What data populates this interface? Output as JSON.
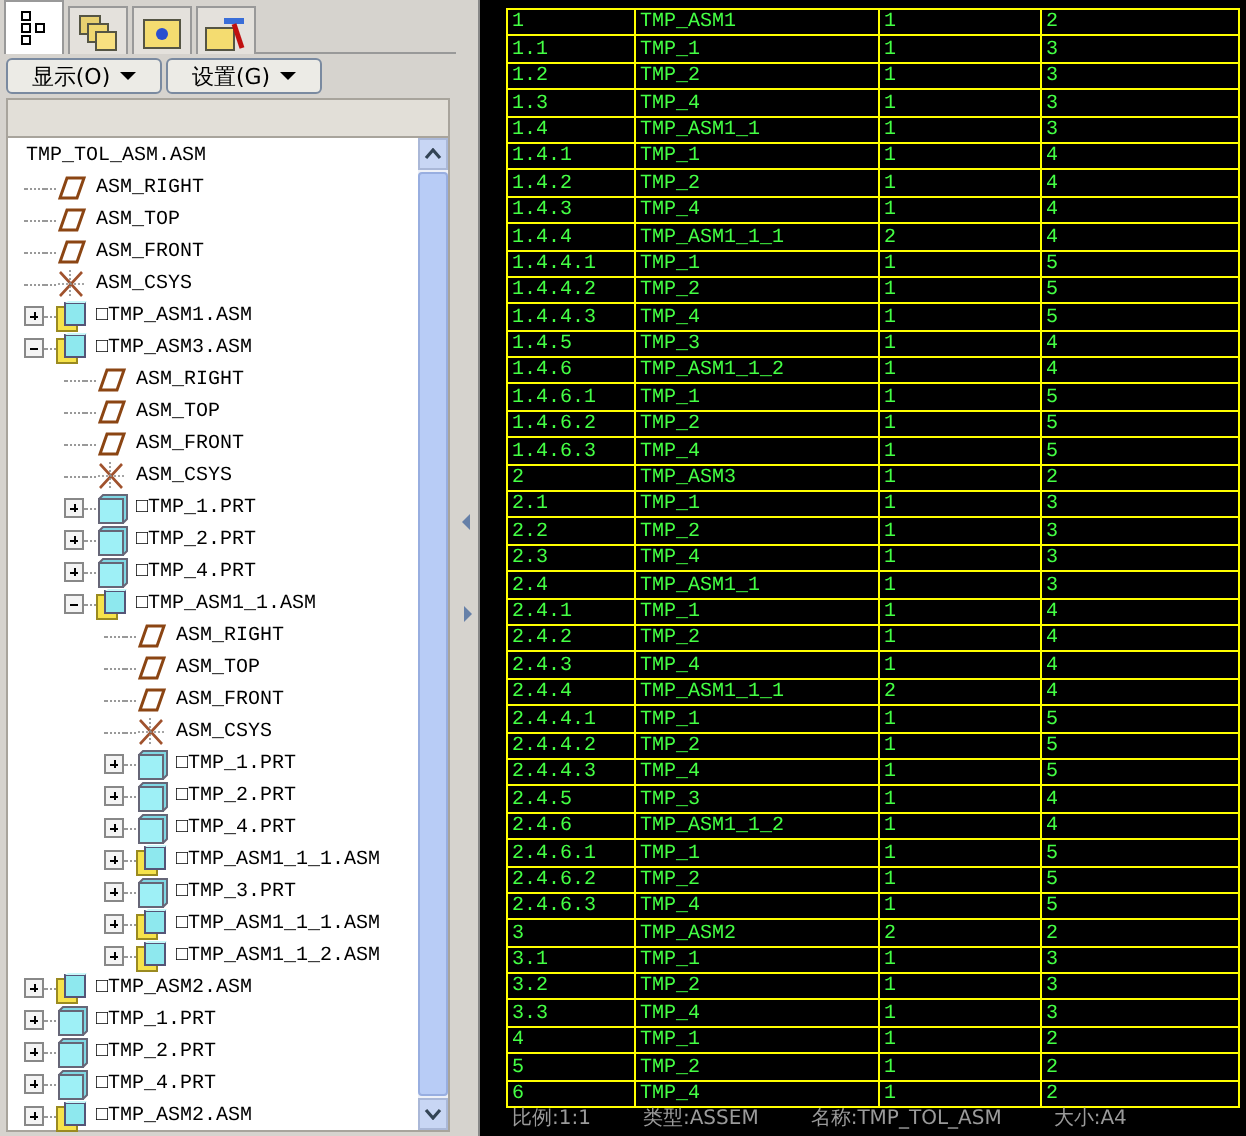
{
  "tabs": [
    {
      "kind": "model-tree",
      "selected": true
    },
    {
      "kind": "folders",
      "selected": false
    },
    {
      "kind": "favorites",
      "selected": false
    },
    {
      "kind": "tools",
      "selected": false
    }
  ],
  "toolbar": {
    "buttons": [
      "显示(O)",
      "设置(G)"
    ]
  },
  "model_tree": {
    "items": [
      {
        "kind": "root",
        "label": "TMP_TOL_ASM.ASM",
        "children": [
          {
            "kind": "datum-plane",
            "label": "ASM_RIGHT"
          },
          {
            "kind": "datum-plane",
            "label": "ASM_TOP"
          },
          {
            "kind": "datum-plane",
            "label": "ASM_FRONT"
          },
          {
            "kind": "csys",
            "label": "ASM_CSYS"
          },
          {
            "kind": "assembly",
            "label": "□TMP_ASM1.ASM",
            "expanded": false
          },
          {
            "kind": "assembly",
            "label": "□TMP_ASM3.ASM",
            "expanded": true,
            "children": [
              {
                "kind": "datum-plane",
                "label": "ASM_RIGHT"
              },
              {
                "kind": "datum-plane",
                "label": "ASM_TOP"
              },
              {
                "kind": "datum-plane",
                "label": "ASM_FRONT"
              },
              {
                "kind": "csys",
                "label": "ASM_CSYS"
              },
              {
                "kind": "part",
                "label": "□TMP_1.PRT",
                "expanded": false
              },
              {
                "kind": "part",
                "label": "□TMP_2.PRT",
                "expanded": false
              },
              {
                "kind": "part",
                "label": "□TMP_4.PRT",
                "expanded": false
              },
              {
                "kind": "assembly",
                "label": "□TMP_ASM1_1.ASM",
                "expanded": true,
                "children": [
                  {
                    "kind": "datum-plane",
                    "label": "ASM_RIGHT"
                  },
                  {
                    "kind": "datum-plane",
                    "label": "ASM_TOP"
                  },
                  {
                    "kind": "datum-plane",
                    "label": "ASM_FRONT"
                  },
                  {
                    "kind": "csys",
                    "label": "ASM_CSYS"
                  },
                  {
                    "kind": "part",
                    "label": "□TMP_1.PRT",
                    "expanded": false
                  },
                  {
                    "kind": "part",
                    "label": "□TMP_2.PRT",
                    "expanded": false
                  },
                  {
                    "kind": "part",
                    "label": "□TMP_4.PRT",
                    "expanded": false
                  },
                  {
                    "kind": "assembly",
                    "label": "□TMP_ASM1_1_1.ASM",
                    "expanded": false
                  },
                  {
                    "kind": "part",
                    "label": "□TMP_3.PRT",
                    "expanded": false
                  },
                  {
                    "kind": "assembly",
                    "label": "□TMP_ASM1_1_1.ASM",
                    "expanded": false
                  },
                  {
                    "kind": "assembly",
                    "label": "□TMP_ASM1_1_2.ASM",
                    "expanded": false
                  }
                ]
              }
            ]
          },
          {
            "kind": "assembly",
            "label": "□TMP_ASM2.ASM",
            "expanded": false
          },
          {
            "kind": "part",
            "label": "□TMP_1.PRT",
            "expanded": false
          },
          {
            "kind": "part",
            "label": "□TMP_2.PRT",
            "expanded": false
          },
          {
            "kind": "part",
            "label": "□TMP_4.PRT",
            "expanded": false
          },
          {
            "kind": "assembly",
            "label": "□TMP_ASM2.ASM",
            "expanded": false
          }
        ]
      }
    ]
  },
  "table": {
    "rows": [
      [
        "1",
        "TMP_ASM1",
        "1",
        "2"
      ],
      [
        "1.1",
        "TMP_1",
        "1",
        "3"
      ],
      [
        "1.2",
        "TMP_2",
        "1",
        "3"
      ],
      [
        "1.3",
        "TMP_4",
        "1",
        "3"
      ],
      [
        "1.4",
        "TMP_ASM1_1",
        "1",
        "3"
      ],
      [
        "1.4.1",
        "TMP_1",
        "1",
        "4"
      ],
      [
        "1.4.2",
        "TMP_2",
        "1",
        "4"
      ],
      [
        "1.4.3",
        "TMP_4",
        "1",
        "4"
      ],
      [
        "1.4.4",
        "TMP_ASM1_1_1",
        "2",
        "4"
      ],
      [
        "1.4.4.1",
        "TMP_1",
        "1",
        "5"
      ],
      [
        "1.4.4.2",
        "TMP_2",
        "1",
        "5"
      ],
      [
        "1.4.4.3",
        "TMP_4",
        "1",
        "5"
      ],
      [
        "1.4.5",
        "TMP_3",
        "1",
        "4"
      ],
      [
        "1.4.6",
        "TMP_ASM1_1_2",
        "1",
        "4"
      ],
      [
        "1.4.6.1",
        "TMP_1",
        "1",
        "5"
      ],
      [
        "1.4.6.2",
        "TMP_2",
        "1",
        "5"
      ],
      [
        "1.4.6.3",
        "TMP_4",
        "1",
        "5"
      ],
      [
        "2",
        "TMP_ASM3",
        "1",
        "2"
      ],
      [
        "2.1",
        "TMP_1",
        "1",
        "3"
      ],
      [
        "2.2",
        "TMP_2",
        "1",
        "3"
      ],
      [
        "2.3",
        "TMP_4",
        "1",
        "3"
      ],
      [
        "2.4",
        "TMP_ASM1_1",
        "1",
        "3"
      ],
      [
        "2.4.1",
        "TMP_1",
        "1",
        "4"
      ],
      [
        "2.4.2",
        "TMP_2",
        "1",
        "4"
      ],
      [
        "2.4.3",
        "TMP_4",
        "1",
        "4"
      ],
      [
        "2.4.4",
        "TMP_ASM1_1_1",
        "2",
        "4"
      ],
      [
        "2.4.4.1",
        "TMP_1",
        "1",
        "5"
      ],
      [
        "2.4.4.2",
        "TMP_2",
        "1",
        "5"
      ],
      [
        "2.4.4.3",
        "TMP_4",
        "1",
        "5"
      ],
      [
        "2.4.5",
        "TMP_3",
        "1",
        "4"
      ],
      [
        "2.4.6",
        "TMP_ASM1_1_2",
        "1",
        "4"
      ],
      [
        "2.4.6.1",
        "TMP_1",
        "1",
        "5"
      ],
      [
        "2.4.6.2",
        "TMP_2",
        "1",
        "5"
      ],
      [
        "2.4.6.3",
        "TMP_4",
        "1",
        "5"
      ],
      [
        "3",
        "TMP_ASM2",
        "2",
        "2"
      ],
      [
        "3.1",
        "TMP_1",
        "1",
        "3"
      ],
      [
        "3.2",
        "TMP_2",
        "1",
        "3"
      ],
      [
        "3.3",
        "TMP_4",
        "1",
        "3"
      ],
      [
        "4",
        "TMP_1",
        "1",
        "2"
      ],
      [
        "5",
        "TMP_2",
        "1",
        "2"
      ],
      [
        "6",
        "TMP_4",
        "1",
        "2"
      ]
    ]
  },
  "status_bar": [
    "比例:1:1",
    "类型:ASSEM",
    "名称:TMP_TOL_ASM",
    "大小:A4"
  ]
}
